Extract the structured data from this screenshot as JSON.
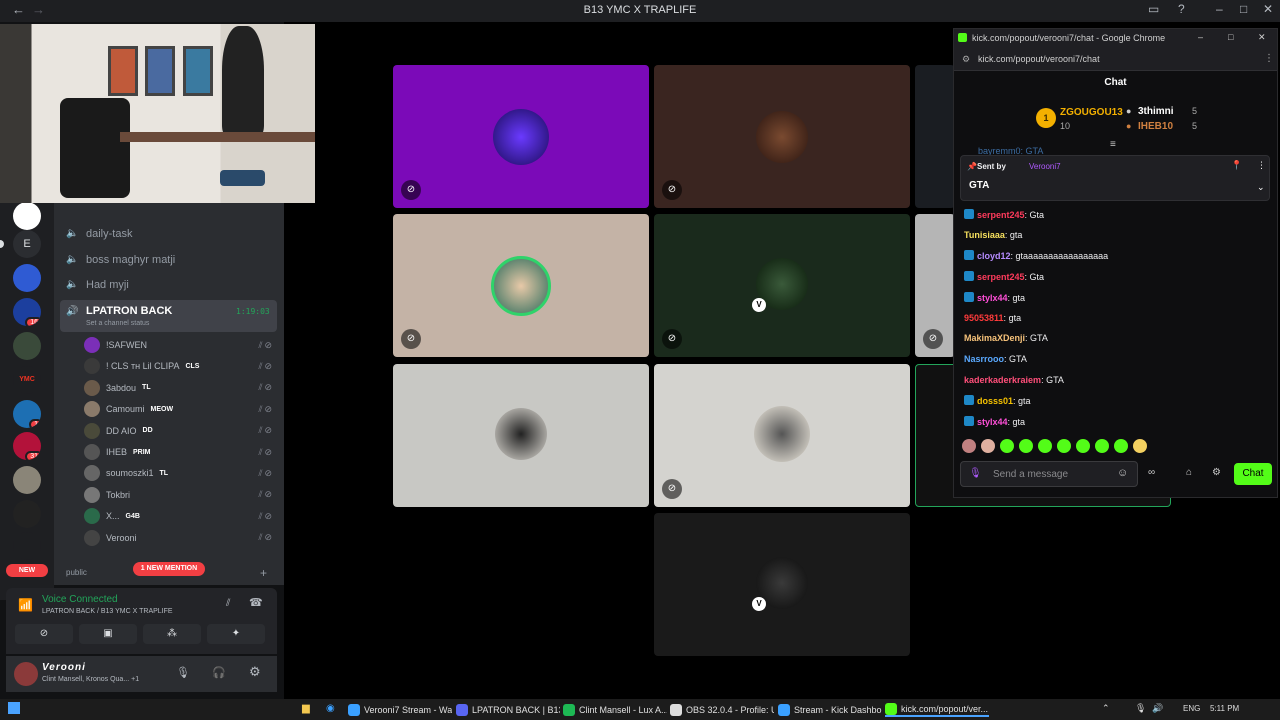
{
  "window": {
    "title": "B13 YMC X TRAPLIFE"
  },
  "channels": {
    "items": [
      "daily-task",
      "boss maghyr matji",
      "Had myji"
    ],
    "active": {
      "name": "LPATRON BACK",
      "timer": "1:19:03",
      "status_hint": "Set a channel status"
    },
    "members": [
      {
        "name": "!SAFWEN",
        "tag": "",
        "color": "#7b2fb8"
      },
      {
        "name": "! CLS ᴛʜ Lil CLIPA",
        "tag": "CLS",
        "color": "#3a3a3a"
      },
      {
        "name": "3abdou",
        "tag": "TL",
        "color": "#6a5a4a"
      },
      {
        "name": "Camoumi",
        "tag": "MEOW",
        "color": "#8a7a6a"
      },
      {
        "name": "DD AIO",
        "tag": "DD",
        "color": "#4a4a3a"
      },
      {
        "name": "IHEB",
        "tag": "PRIM",
        "color": "#555"
      },
      {
        "name": "soumoszki1",
        "tag": "TL",
        "color": "#666"
      },
      {
        "name": "Tokbri",
        "tag": "",
        "color": "#777"
      },
      {
        "name": "X...",
        "tag": "G4B",
        "color": "#2a6a4a"
      },
      {
        "name": "Verooni",
        "tag": "",
        "color": "#444"
      }
    ],
    "category": "public",
    "new_mention": "1 NEW MENTION",
    "new_label": "NEW"
  },
  "rail": {
    "letter": "E",
    "badges": [
      "16",
      "1",
      "31"
    ]
  },
  "voice": {
    "status": "Voice Connected",
    "location": "LPATRON BACK / B13 YMC X TRAPLIFE"
  },
  "user": {
    "name": "Verooni",
    "activity": "Clint Mansell, Kronos Qua...",
    "extra": "+1"
  },
  "chat": {
    "window_title": "kick.com/popout/verooni7/chat - Google Chrome",
    "url": "kick.com/popout/verooni7/chat",
    "header": "Chat",
    "leaderboard": [
      {
        "rank": "1",
        "name": "ZGOUGOU13",
        "count": "10"
      },
      {
        "name": "3thimni",
        "count": "5"
      },
      {
        "name": "IHEB10",
        "count": "5"
      }
    ],
    "pinned": {
      "sent_by_label": "Sent by",
      "sender": "Verooni7",
      "text": "GTA",
      "partial_above": "bayremm0: GTA"
    },
    "messages": [
      {
        "user": "serpent245",
        "text": "Gta",
        "color": "#ff3b5c",
        "badge": true
      },
      {
        "user": "Tunisiaaa",
        "text": "gta",
        "color": "#f6e05e",
        "badge": false
      },
      {
        "user": "cloyd12",
        "text": "gtaaaaaaaaaaaaaaaaa",
        "color": "#b68cff",
        "badge": true
      },
      {
        "user": "serpent245",
        "text": "Gta",
        "color": "#ff3b5c",
        "badge": true
      },
      {
        "user": "stylx44",
        "text": "gta",
        "color": "#ff4fd8",
        "badge": true
      },
      {
        "user": "95053811",
        "text": "gta",
        "color": "#ff3b3b",
        "badge": false
      },
      {
        "user": "MakimaXDenji",
        "text": "GTA",
        "color": "#f6c27a",
        "badge": false
      },
      {
        "user": "Nasrrooo",
        "text": "GTA",
        "color": "#5aa9ff",
        "badge": false
      },
      {
        "user": "kaderkaderkraiem",
        "text": "GTA",
        "color": "#ff4f7a",
        "badge": false
      },
      {
        "user": "dosss01",
        "text": "gta",
        "color": "#f6c200",
        "badge": true
      },
      {
        "user": "stylx44",
        "text": "gta",
        "color": "#ff4fd8",
        "badge": true
      }
    ],
    "input_placeholder": "Send a message",
    "send_label": "Chat"
  },
  "taskbar": {
    "items": [
      "Verooni7 Stream - Wa...",
      "LPATRON BACK | B13 ...",
      "Clint Mansell - Lux A...",
      "OBS 32.0.4 - Profile: U...",
      "Stream - Kick Dashbo...",
      "kick.com/popout/ver..."
    ],
    "lang": "ENG",
    "time": "5:11 PM"
  },
  "colors": {
    "accent_green": "#53fc18",
    "discord_bg": "#2b2d31",
    "voice_green": "#23a55a"
  }
}
